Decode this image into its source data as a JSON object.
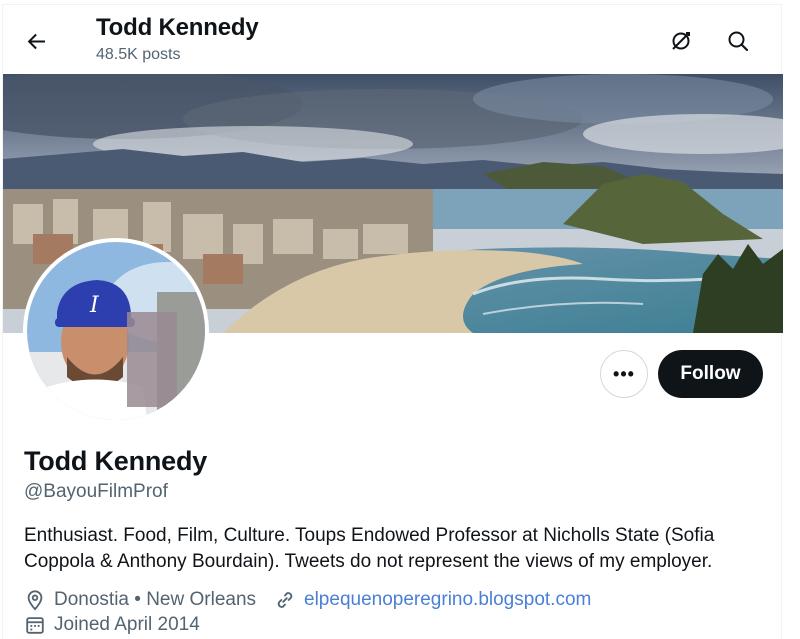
{
  "header": {
    "title": "Todd Kennedy",
    "posts": "48.5K posts",
    "back_icon": "arrow-left-icon",
    "icons": [
      "refresh-off-icon",
      "search-icon"
    ]
  },
  "banner": {
    "description": "coastal city bay panorama"
  },
  "actions": {
    "more_label": "•••",
    "follow_label": "Follow"
  },
  "profile": {
    "name": "Todd Kennedy",
    "handle": "@BayouFilmProf",
    "bio": "Enthusiast. Food, Film, Culture. Toups Endowed Professor at Nicholls State (Sofia Coppola & Anthony Bourdain). Tweets do not represent the views of my employer.",
    "location": "Donostia • New Orleans",
    "website": "elpequenoperegrino.blogspot.com",
    "joined": "Joined April 2014"
  },
  "colors": {
    "text": "#0f1419",
    "secondary": "#536471",
    "link": "#4a7fd6",
    "follow_bg": "#0f1419"
  }
}
